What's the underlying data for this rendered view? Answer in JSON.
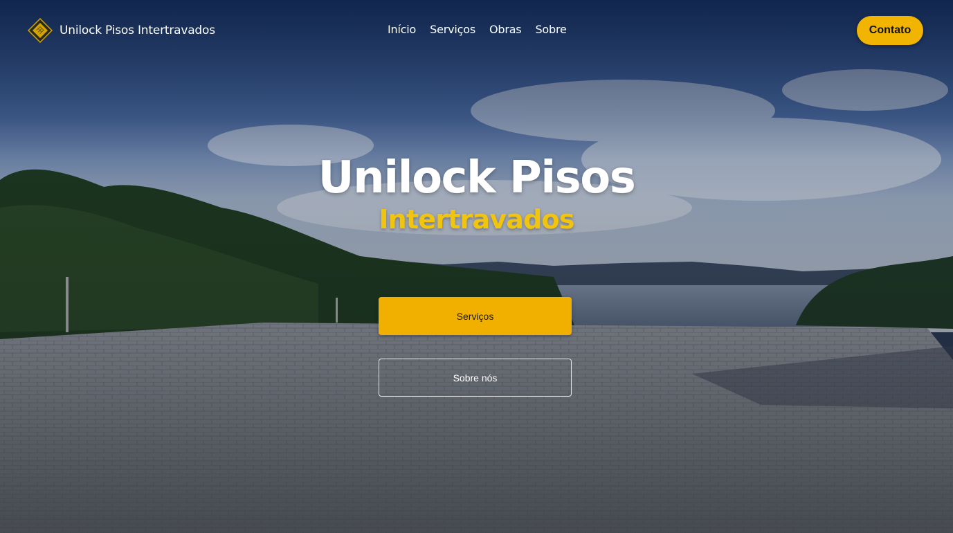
{
  "brand": {
    "name": "Unilock Pisos Intertravados",
    "logo_icon": "diamond-paver-logo-icon"
  },
  "nav": {
    "items": [
      {
        "label": "Início"
      },
      {
        "label": "Serviços"
      },
      {
        "label": "Obras"
      },
      {
        "label": "Sobre"
      }
    ],
    "contact_label": "Contato"
  },
  "hero": {
    "title": "Unilock Pisos",
    "subtitle": "Intertravados",
    "primary_button": "Serviços",
    "secondary_button": "Sobre nós"
  },
  "colors": {
    "accent": "#f1b400",
    "subtitle": "#f1c40f",
    "text": "#ffffff"
  }
}
